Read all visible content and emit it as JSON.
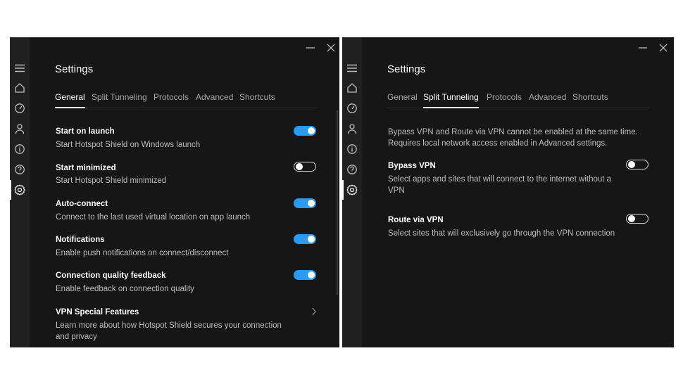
{
  "left": {
    "title": "Settings",
    "tabs": [
      {
        "label": "General",
        "active": true
      },
      {
        "label": "Split Tunneling",
        "active": false
      },
      {
        "label": "Protocols",
        "active": false
      },
      {
        "label": "Advanced",
        "active": false
      },
      {
        "label": "Shortcuts",
        "active": false
      }
    ],
    "settings": [
      {
        "title": "Start on launch",
        "desc": "Start Hotspot Shield on Windows launch",
        "toggle": "on"
      },
      {
        "title": "Start minimized",
        "desc": "Start Hotspot Shield minimized",
        "toggle": "off"
      },
      {
        "title": "Auto-connect",
        "desc": "Connect to the last used virtual location on app launch",
        "toggle": "on"
      },
      {
        "title": "Notifications",
        "desc": "Enable push notifications on connect/disconnect",
        "toggle": "on"
      },
      {
        "title": "Connection quality feedback",
        "desc": "Enable feedback on connection quality",
        "toggle": "on"
      },
      {
        "title": "VPN Special Features",
        "desc": "Learn more about how Hotspot Shield secures your connection and privacy",
        "control": "chevron"
      }
    ]
  },
  "right": {
    "title": "Settings",
    "tabs": [
      {
        "label": "General",
        "active": false
      },
      {
        "label": "Split Tunneling",
        "active": true
      },
      {
        "label": "Protocols",
        "active": false
      },
      {
        "label": "Advanced",
        "active": false
      },
      {
        "label": "Shortcuts",
        "active": false
      }
    ],
    "info": "Bypass VPN and Route via VPN cannot be enabled at the same time. Requires local network access enabled in Advanced settings.",
    "settings": [
      {
        "title": "Bypass VPN",
        "desc": "Select apps and sites that will connect to the internet without a VPN",
        "toggle": "off"
      },
      {
        "title": "Route via VPN",
        "desc": "Select sites that will exclusively go through the VPN connection",
        "toggle": "off"
      }
    ]
  },
  "sidebar_icons": [
    "menu-icon",
    "home-icon",
    "speed-icon",
    "account-icon",
    "info-icon",
    "help-icon",
    "settings-icon"
  ],
  "colors": {
    "accent": "#2b9af3",
    "background": "#161616",
    "rail": "#202020"
  }
}
